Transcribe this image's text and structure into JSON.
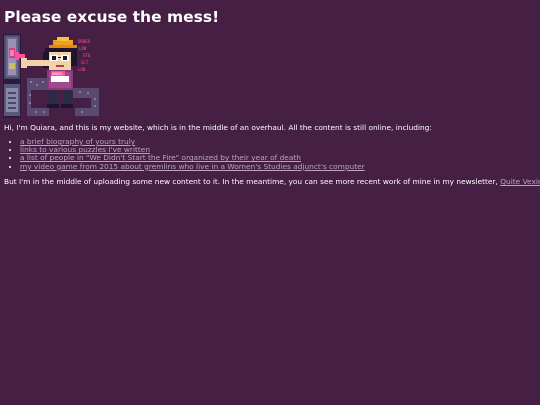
{
  "page": {
    "heading": "Please excuse the mess!",
    "background_color": "#461f45",
    "link_color": "#b9a4c4"
  },
  "intro": {
    "text": "Hi, I'm Quiara, and this is my website, which is in the middle of an overhaul. All the content is still online, including:"
  },
  "links": [
    {
      "label": "a brief biography of yours truly"
    },
    {
      "label": "links to various puzzles I've written"
    },
    {
      "label": "a list of people in \"We Didn't Start the Fire\" organized by their year of death"
    },
    {
      "label": "my video game from 2015 about gremlins who live in a Women's Studies adjunct's computer"
    }
  ],
  "outro": {
    "text": "But I'm in the middle of uploading some new content to it. In the meantime, you can see more recent work of mine in my newsletter,",
    "link_label": "Quite Vexing."
  },
  "illustration": {
    "icon": "pixel-art-character-icon",
    "screen_text": [
      "ORDER",
      "LOB",
      "STO",
      "SLT",
      "LOB"
    ],
    "tag_text": "ORDER"
  }
}
